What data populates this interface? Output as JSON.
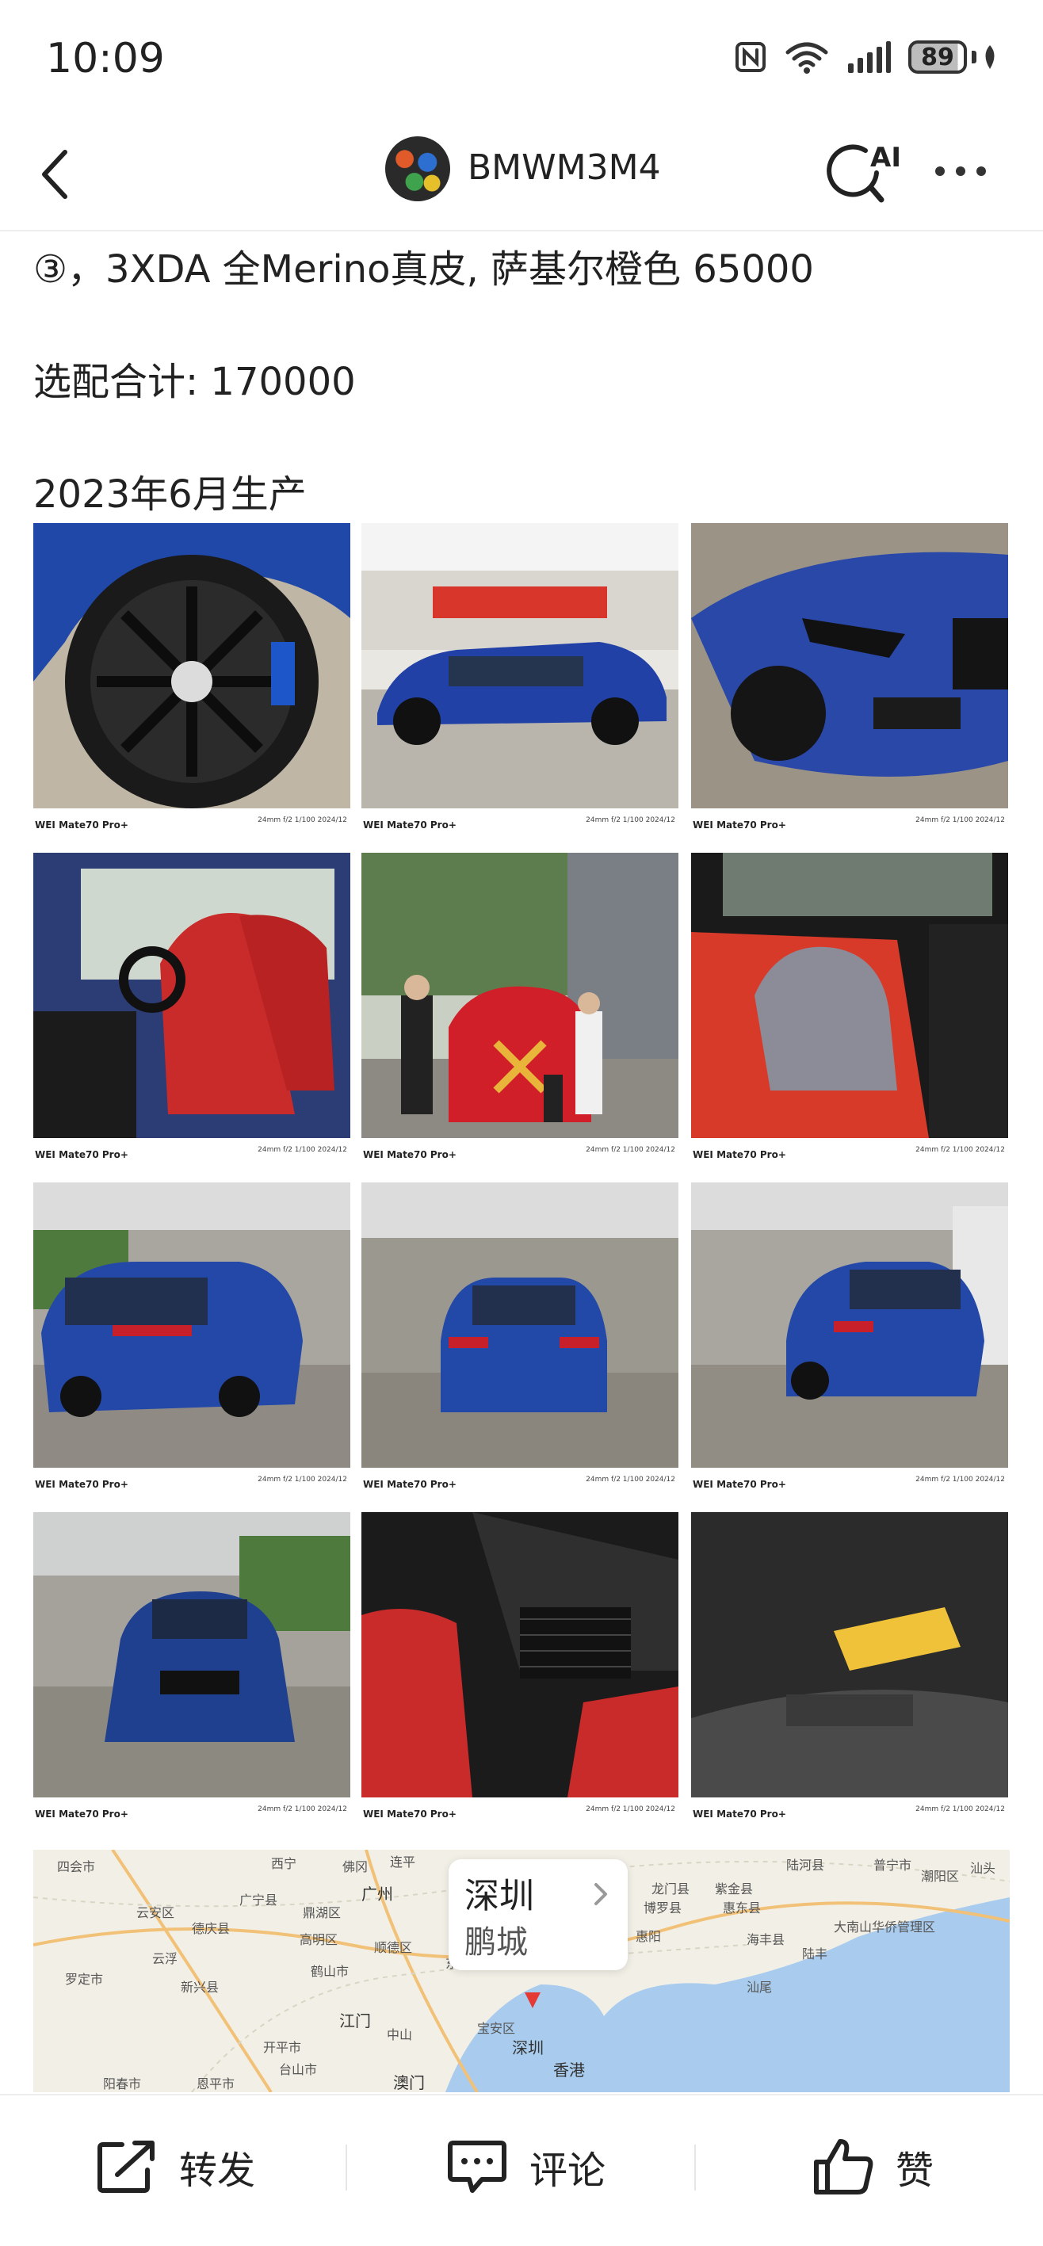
{
  "status_bar": {
    "time": "10:09",
    "battery": "89"
  },
  "nav": {
    "username": "BMWM3M4",
    "ai_badge": "AI"
  },
  "post": {
    "lines": [
      "③，3XDA 全Merino真皮, 萨基尔橙色 65000",
      "选配合计: 170000",
      "2023年6月生产"
    ]
  },
  "photos": {
    "watermark_left": "WEI Mate70 Pro+",
    "watermark_right": "24mm f/2 1/100 2024/12",
    "items": [
      {
        "subject": "wheel-closeup"
      },
      {
        "subject": "suv-side-gas-station"
      },
      {
        "subject": "suv-front-quarter"
      },
      {
        "subject": "red-interior-front-seats"
      },
      {
        "subject": "family-delivery-photo"
      },
      {
        "subject": "red-interior-rear-child-seat"
      },
      {
        "subject": "suv-rear-quarter-left"
      },
      {
        "subject": "suv-rear-center"
      },
      {
        "subject": "suv-rear-quarter-right"
      },
      {
        "subject": "suv-front-gas-station"
      },
      {
        "subject": "interior-console-carbon"
      },
      {
        "subject": "sun-visor-airbag-label"
      }
    ]
  },
  "map": {
    "city": "深圳",
    "district": "鹏城",
    "labels": [
      "西宁",
      "佛冈",
      "连平",
      "陆河县",
      "普宁市",
      "潮阳区",
      "汕头",
      "广宁县",
      "鼎湖区",
      "广州",
      "博罗县",
      "惠东县",
      "惠阳",
      "海丰县",
      "陆丰",
      "大南山华侨管理区",
      "云安区",
      "德庆县",
      "高明区",
      "顺德区",
      "东莞",
      "龙门县",
      "紫金县",
      "汕尾",
      "云浮",
      "新兴县",
      "鹤山市",
      "江门",
      "中山",
      "宝安区",
      "深圳",
      "香港",
      "罗定市",
      "开平市",
      "台山市",
      "澳门",
      "阳春市",
      "恩平市",
      "四会市"
    ]
  },
  "actions": {
    "share": "转发",
    "comment": "评论",
    "like": "赞"
  }
}
